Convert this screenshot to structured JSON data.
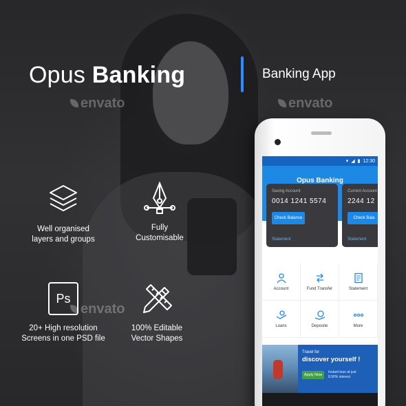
{
  "headline": {
    "light": "Opus",
    "bold": "Banking"
  },
  "subheading": "Banking App",
  "watermark": "envato",
  "features": [
    {
      "icon": "layers-icon",
      "text": "Well organised\nlayers and groups"
    },
    {
      "icon": "pen-tool-icon",
      "text": "Fully\nCustomisable"
    },
    {
      "icon": "photoshop-icon",
      "icon_text": "Ps",
      "text": "20+ High resolution\nScreens in one PSD file"
    },
    {
      "icon": "pencil-ruler-icon",
      "text": "100% Editable\nVector Shapes"
    }
  ],
  "phone": {
    "time": "12:30",
    "app_title": "Opus Banking",
    "cards": [
      {
        "type": "Saving Account",
        "number": "0014 1241 5574",
        "button": "Check Balance",
        "link": "Statement"
      },
      {
        "type": "Current Account",
        "number": "2244 12",
        "button": "Check Bala",
        "link": "Statement"
      }
    ],
    "menu": [
      {
        "label": "Account",
        "icon": "account-icon"
      },
      {
        "label": "Fund Transfer",
        "icon": "transfer-icon"
      },
      {
        "label": "Statement",
        "icon": "statement-icon"
      },
      {
        "label": "Loans",
        "icon": "loans-icon"
      },
      {
        "label": "Deposite",
        "icon": "deposit-icon"
      },
      {
        "label": "More",
        "icon": "more-icon"
      }
    ],
    "banner": {
      "small": "Travel for",
      "big": "discover yourself !",
      "button": "Apply Now",
      "note": "Instant loan at just 8.90% interest"
    }
  },
  "colors": {
    "accent": "#2f8cff",
    "appbar": "#1e88e5",
    "card": "#3a3a3e",
    "apply": "#43a047"
  }
}
